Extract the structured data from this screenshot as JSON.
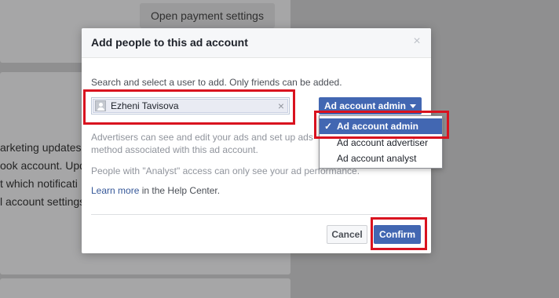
{
  "background": {
    "button_label": "Open payment settings",
    "lines": [
      "arketing updates",
      "ook account. Upd",
      "t which notificati",
      "l account settings"
    ]
  },
  "dialog": {
    "title": "Add people to this ad account",
    "close_glyph": "×",
    "instruction": "Search and select a user to add. Only friends can be added.",
    "selected_user": "Ezheni Tavisova",
    "token_remove_glyph": "×",
    "role_button_label": "Ad account admin",
    "description_1": "Advertisers can see and edit your ads and set up ads method associated with this ad account.",
    "description_2": "People with \"Analyst\" access can only see your ad performance.",
    "help_link": "Learn more",
    "help_suffix": " in the Help Center.",
    "cancel_label": "Cancel",
    "confirm_label": "Confirm"
  },
  "role_menu": {
    "check_glyph": "✓",
    "items": [
      {
        "label": "Ad account admin",
        "selected": true
      },
      {
        "label": "Ad account advertiser",
        "selected": false
      },
      {
        "label": "Ad account analyst",
        "selected": false
      }
    ]
  },
  "colors": {
    "primary": "#4267b2",
    "highlight_annotation": "#d9121f",
    "link": "#365899"
  }
}
